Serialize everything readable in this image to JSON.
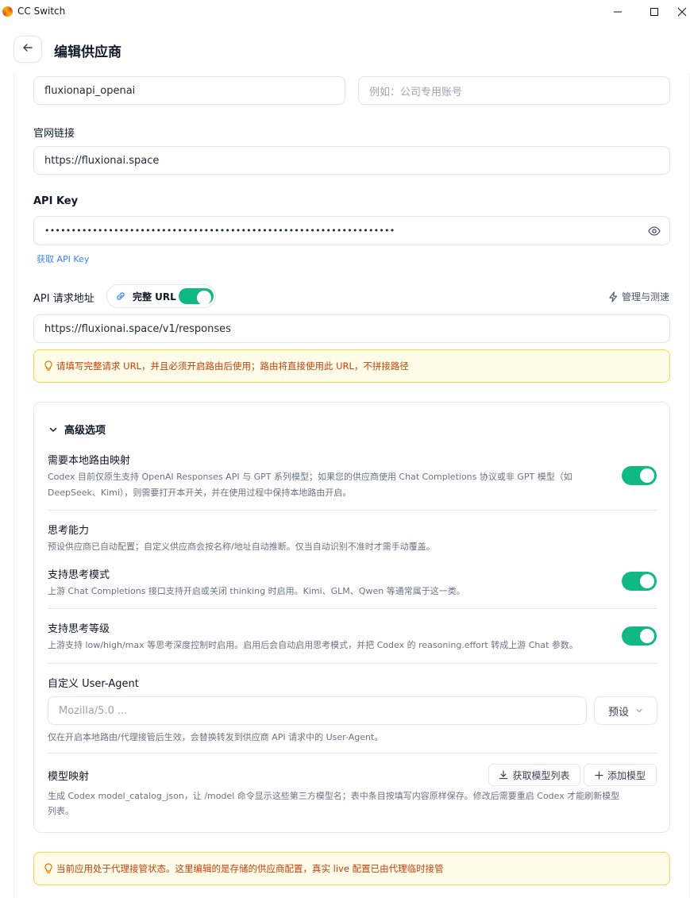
{
  "window": {
    "title": "CC Switch"
  },
  "header": {
    "title": "编辑供应商"
  },
  "form": {
    "name_value": "fluxionapi_openai",
    "note_placeholder": "例如：公司专用账号",
    "website_label": "官网链接",
    "website_value": "https://fluxionai.space",
    "api_key_label": "API Key",
    "api_key_value": "••••••••••••••••••••••••••••••••••••••••••••••••••••••••••••••••••",
    "get_api_key_link": "获取 API Key",
    "endpoint_label": "API 请求地址",
    "full_url_label": "完整 URL",
    "full_url_enabled": true,
    "manage_test_label": "管理与测速",
    "endpoint_value": "https://fluxionai.space/v1/responses",
    "full_url_notice": "请填写完整请求 URL，并且必须开启路由后使用；路由将直接使用此 URL，不拼接路径"
  },
  "advanced": {
    "title": "高级选项",
    "local_routing": {
      "title": "需要本地路由映射",
      "desc_line1": "Codex 目前仅原生支持 OpenAI Responses API 与 GPT 系列模型；如果您的供应商使用 Chat Completions 协议或非 GPT 模型（如",
      "desc_line2": "DeepSeek、Kimi），则需要打开本开关，并在使用过程中保持本地路由开启。",
      "enabled": true
    },
    "thinking": {
      "title": "思考能力",
      "desc": "预设供应商已自动配置；自定义供应商会按名称/地址自动推断。仅当自动识别不准时才需手动覆盖。"
    },
    "thinking_mode": {
      "title": "支持思考模式",
      "desc": "上游 Chat Completions 接口支持开启或关闭 thinking 时启用。Kimi、GLM、Qwen 等通常属于这一类。",
      "enabled": true
    },
    "thinking_level": {
      "title": "支持思考等级",
      "desc": "上游支持 low/high/max 等思考深度控制时启用。启用后会自动启用思考模式，并把 Codex 的 reasoning.effort 转成上游 Chat 参数。",
      "enabled": true
    },
    "user_agent": {
      "title": "自定义 User-Agent",
      "placeholder": "Mozilla/5.0 ...",
      "preset_label": "预设",
      "desc": "仅在开启本地路由/代理接管后生效，会替换转发到供应商 API 请求中的 User-Agent。"
    },
    "model_mapping": {
      "title": "模型映射",
      "fetch_label": "获取模型列表",
      "add_label": "添加模型",
      "desc_line1": "生成 Codex model_catalog_json，让 /model 命令显示这些第三方模型名；表中条目按填写内容原样保存。修改后需要重启 Codex 才能刷新模型",
      "desc_line2": "列表。"
    }
  },
  "proxy_notice": "当前应用处于代理接管状态。这里编辑的是存储的供应商配置，真实 live 配置已由代理临时接管",
  "colors": {
    "accent": "#10b981",
    "link": "#3b82f6",
    "warning_text": "#c2410c",
    "warning_bg": "#fefce8"
  }
}
